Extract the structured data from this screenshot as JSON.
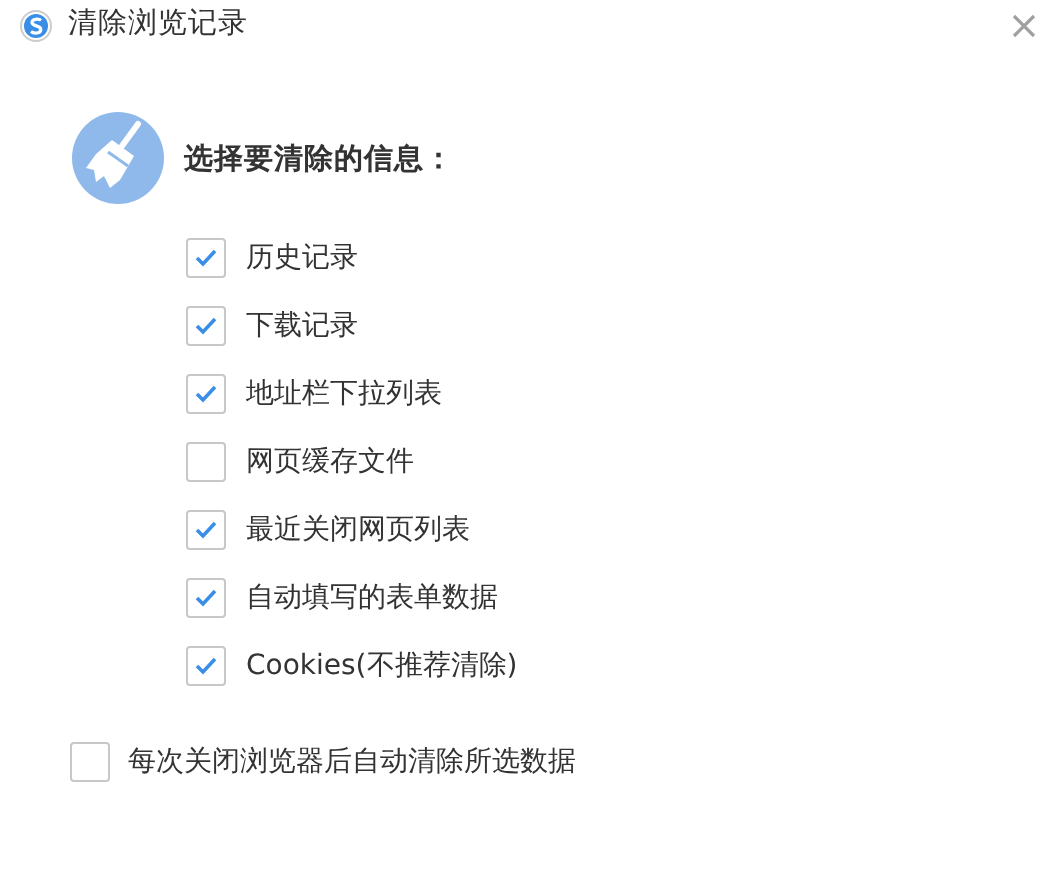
{
  "window": {
    "title": "清除浏览记录"
  },
  "heading": "选择要清除的信息：",
  "options": [
    {
      "label": "历史记录",
      "checked": true
    },
    {
      "label": "下载记录",
      "checked": true
    },
    {
      "label": "地址栏下拉列表",
      "checked": true
    },
    {
      "label": "网页缓存文件",
      "checked": false
    },
    {
      "label": "最近关闭网页列表",
      "checked": true
    },
    {
      "label": "自动填写的表单数据",
      "checked": true
    },
    {
      "label": "Cookies(不推荐清除)",
      "checked": true
    }
  ],
  "auto_clear": {
    "label": "每次关闭浏览器后自动清除所选数据",
    "checked": false
  }
}
